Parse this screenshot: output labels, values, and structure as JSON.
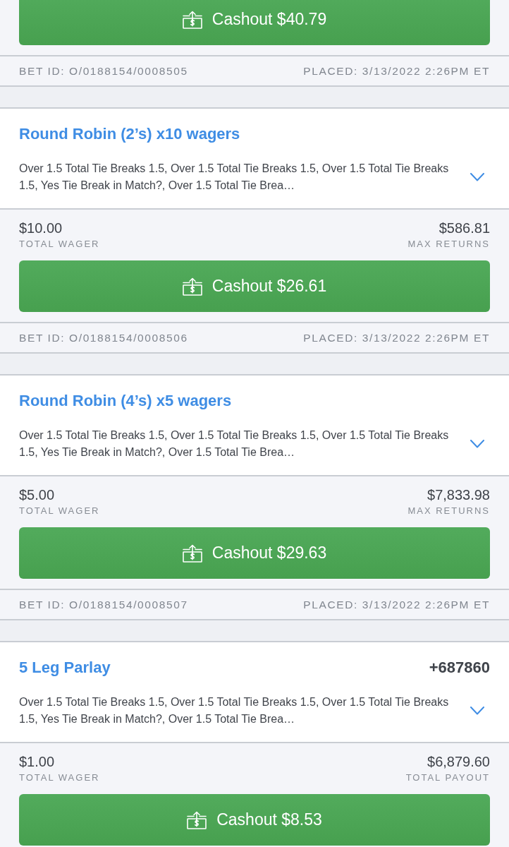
{
  "bets": [
    {
      "cashout_button": "Cashout $40.79",
      "bet_id": "BET ID: O/0188154/0008505",
      "placed": "PLACED: 3/13/2022 2:26PM ET"
    },
    {
      "title": "Round Robin (2’s) x10 wagers",
      "legs": "Over 1.5 Total Tie Breaks 1.5, Over 1.5 Total Tie Breaks 1.5, Over 1.5 Total Tie Breaks 1.5, Yes Tie Break in Match?, Over 1.5 Total Tie Brea…",
      "expanded": false,
      "wager": "$10.00",
      "wager_label": "TOTAL WAGER",
      "returns": "$586.81",
      "returns_label": "MAX RETURNS",
      "cashout_button": "Cashout $26.61",
      "bet_id": "BET ID: O/0188154/0008506",
      "placed": "PLACED: 3/13/2022 2:26PM ET"
    },
    {
      "title": "Round Robin (4’s) x5 wagers",
      "legs": "Over 1.5 Total Tie Breaks 1.5, Over 1.5 Total Tie Breaks 1.5, Over 1.5 Total Tie Breaks 1.5, Yes Tie Break in Match?, Over 1.5 Total Tie Brea…",
      "expanded": false,
      "wager": "$5.00",
      "wager_label": "TOTAL WAGER",
      "returns": "$7,833.98",
      "returns_label": "MAX RETURNS",
      "cashout_button": "Cashout $29.63",
      "bet_id": "BET ID: O/0188154/0008507",
      "placed": "PLACED: 3/13/2022 2:26PM ET"
    },
    {
      "title": "5 Leg Parlay",
      "odds": "+687860",
      "legs": "Over 1.5 Total Tie Breaks 1.5, Over 1.5 Total Tie Breaks 1.5, Over 1.5 Total Tie Breaks 1.5, Yes Tie Break in Match?, Over 1.5 Total Tie Brea…",
      "expanded": false,
      "wager": "$1.00",
      "wager_label": "TOTAL WAGER",
      "returns": "$6,879.60",
      "returns_label": "TOTAL PAYOUT",
      "cashout_button": "Cashout $8.53"
    }
  ]
}
